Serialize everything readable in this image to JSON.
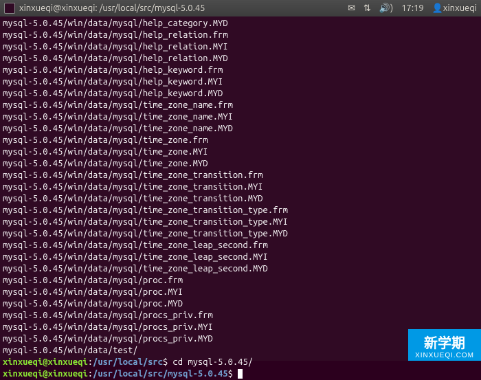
{
  "menubar": {
    "title": "xinxueqi@xinxueqi: /usr/local/src/mysql-5.0.45",
    "time": "17:19",
    "username": "xinxueqi"
  },
  "terminal": {
    "output_lines": [
      "mysql-5.0.45/win/data/mysql/help_category.MYD",
      "mysql-5.0.45/win/data/mysql/help_relation.frm",
      "mysql-5.0.45/win/data/mysql/help_relation.MYI",
      "mysql-5.0.45/win/data/mysql/help_relation.MYD",
      "mysql-5.0.45/win/data/mysql/help_keyword.frm",
      "mysql-5.0.45/win/data/mysql/help_keyword.MYI",
      "mysql-5.0.45/win/data/mysql/help_keyword.MYD",
      "mysql-5.0.45/win/data/mysql/time_zone_name.frm",
      "mysql-5.0.45/win/data/mysql/time_zone_name.MYI",
      "mysql-5.0.45/win/data/mysql/time_zone_name.MYD",
      "mysql-5.0.45/win/data/mysql/time_zone.frm",
      "mysql-5.0.45/win/data/mysql/time_zone.MYI",
      "mysql-5.0.45/win/data/mysql/time_zone.MYD",
      "mysql-5.0.45/win/data/mysql/time_zone_transition.frm",
      "mysql-5.0.45/win/data/mysql/time_zone_transition.MYI",
      "mysql-5.0.45/win/data/mysql/time_zone_transition.MYD",
      "mysql-5.0.45/win/data/mysql/time_zone_transition_type.frm",
      "mysql-5.0.45/win/data/mysql/time_zone_transition_type.MYI",
      "mysql-5.0.45/win/data/mysql/time_zone_transition_type.MYD",
      "mysql-5.0.45/win/data/mysql/time_zone_leap_second.frm",
      "mysql-5.0.45/win/data/mysql/time_zone_leap_second.MYI",
      "mysql-5.0.45/win/data/mysql/time_zone_leap_second.MYD",
      "mysql-5.0.45/win/data/mysql/proc.frm",
      "mysql-5.0.45/win/data/mysql/proc.MYI",
      "mysql-5.0.45/win/data/mysql/proc.MYD",
      "mysql-5.0.45/win/data/mysql/procs_priv.frm",
      "mysql-5.0.45/win/data/mysql/procs_priv.MYI",
      "mysql-5.0.45/win/data/mysql/procs_priv.MYD",
      "mysql-5.0.45/win/data/test/"
    ],
    "prompt1": {
      "user_host": "xinxueqi@xinxueqi",
      "sep1": ":",
      "path": "/usr/local/src",
      "sep2": "$",
      "command": " cd mysql-5.0.45/"
    },
    "prompt2": {
      "user_host": "xinxueqi@xinxueqi",
      "sep1": ":",
      "path": "/usr/local/src/mysql-5.0.45",
      "sep2": "$",
      "command": " "
    }
  },
  "watermark": {
    "main": "新学期",
    "sub": "XINXUEQI.COM"
  }
}
